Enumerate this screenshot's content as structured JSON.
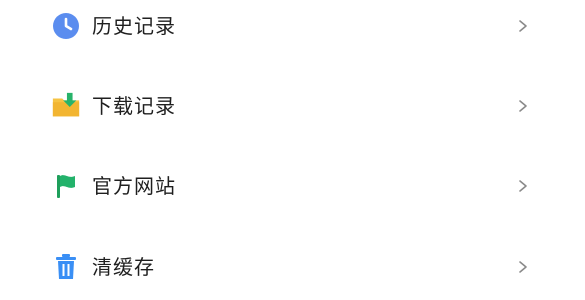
{
  "menu": {
    "items": [
      {
        "label": "历史记录",
        "icon": "clock-icon",
        "color": "#5b8def"
      },
      {
        "label": "下载记录",
        "icon": "download-folder-icon",
        "color": "#f6c343"
      },
      {
        "label": "官方网站",
        "icon": "flag-icon",
        "color": "#23b26b"
      },
      {
        "label": "清缓存",
        "icon": "trash-icon",
        "color": "#3a8ff5"
      }
    ]
  }
}
